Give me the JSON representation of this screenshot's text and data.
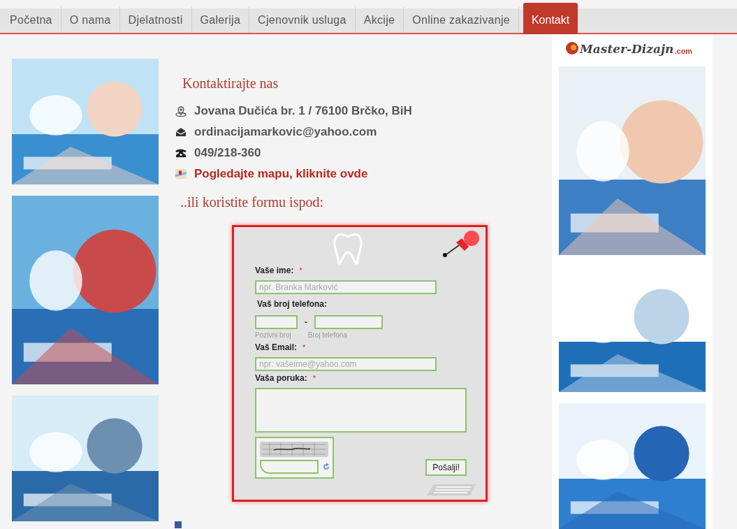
{
  "nav": {
    "items": [
      {
        "label": "Početna",
        "selected": false
      },
      {
        "label": "O nama",
        "selected": false
      },
      {
        "label": "Djelatnosti",
        "selected": false
      },
      {
        "label": "Galerija",
        "selected": false
      },
      {
        "label": "Cjenovnik usluga",
        "selected": false
      },
      {
        "label": "Akcije",
        "selected": false
      },
      {
        "label": "Online zakazivanje",
        "selected": false
      },
      {
        "label": "Kontakt",
        "selected": true
      }
    ]
  },
  "logo": {
    "name": "Master-Dizajn",
    "domain": ".com"
  },
  "contact": {
    "title": "Kontaktirajte nas",
    "items": [
      {
        "kind": "address",
        "text": "Jovana Dučića br. 1 / 76100 Brčko, BiH"
      },
      {
        "kind": "email",
        "text": "ordinacijamarkovic@yahoo.com"
      },
      {
        "kind": "phone",
        "text": "049/218-360"
      },
      {
        "kind": "map",
        "text": "Pogledajte mapu, kliknite ovde"
      }
    ],
    "form_intro": "..ili koristite formu ispod:"
  },
  "form": {
    "name": {
      "label": "Vaše ime:",
      "required": true,
      "placeholder": "npr. Branka Marković"
    },
    "phone": {
      "label": "Vaš broj telefona:",
      "separator": "-",
      "area_hint": "Pozivni broj",
      "number_hint": "Broj telefona"
    },
    "email": {
      "label": "Vaš Email:",
      "required": true,
      "placeholder": "npr: vašeime@yahoo.com"
    },
    "message": {
      "label": "Vaša poruka:",
      "required": true
    },
    "required_mark": "*",
    "submit": "Pošalji!"
  }
}
